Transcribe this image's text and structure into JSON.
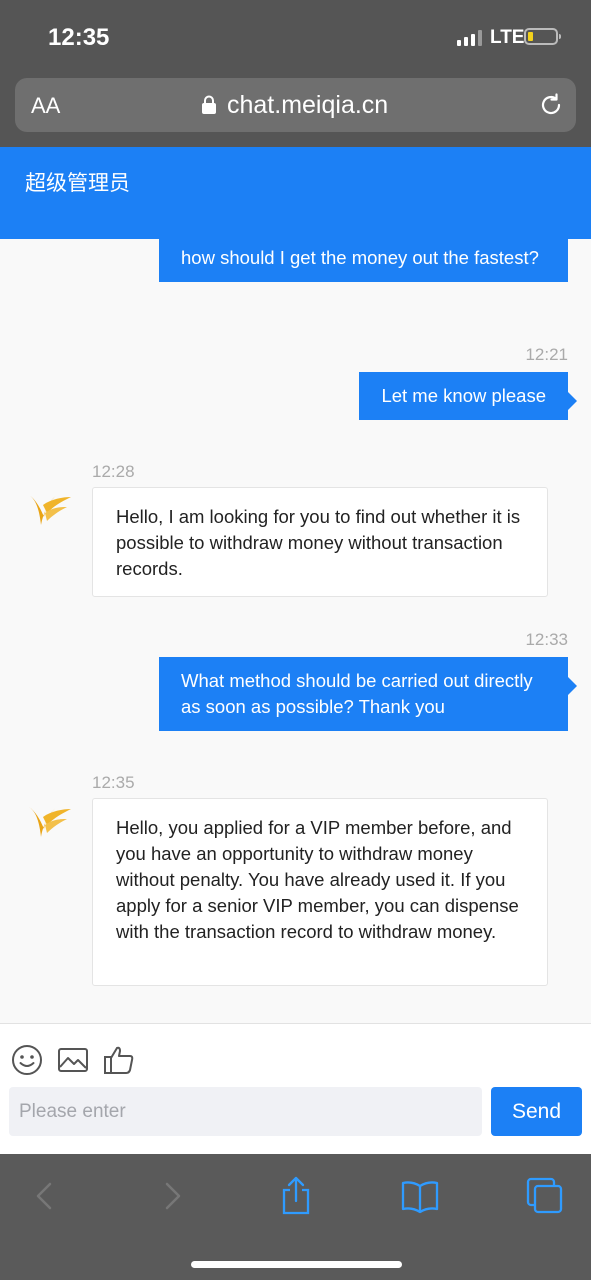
{
  "status": {
    "time": "12:35",
    "network": "LTE"
  },
  "browser": {
    "text_size": "AA",
    "url": "chat.meiqia.cn"
  },
  "chat": {
    "title": "超级管理员",
    "messages": [
      {
        "from": "me",
        "text": "how should I get the money out the fastest?"
      },
      {
        "from": "me",
        "time": "12:21",
        "text": "Let me know please"
      },
      {
        "from": "agent",
        "time": "12:28",
        "text": "Hello, I am looking for you to find out whether it is possible to withdraw money without transaction records."
      },
      {
        "from": "me",
        "time": "12:33",
        "text": "What method should be carried out directly as soon as possible? Thank you"
      },
      {
        "from": "agent",
        "time": "12:35",
        "text": "Hello, you applied for a VIP member before, and you have an opportunity to withdraw money without penalty. You have already used it. If you apply for a senior VIP member, you can dispense with the transaction record to withdraw money."
      }
    ]
  },
  "composer": {
    "placeholder": "Please enter",
    "send_label": "Send"
  },
  "colors": {
    "accent": "#1c80f5",
    "logo_gold": "#e9a416"
  },
  "icons": [
    "emoji-icon",
    "image-icon",
    "thumbs-up-icon",
    "back-icon",
    "forward-icon",
    "share-icon",
    "bookmarks-icon",
    "tabs-icon"
  ]
}
